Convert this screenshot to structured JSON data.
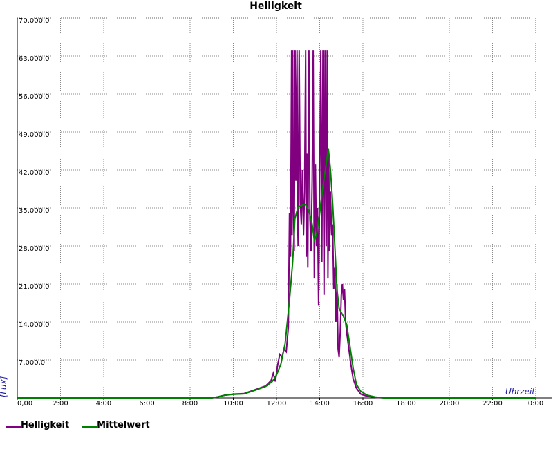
{
  "chart_data": {
    "type": "line",
    "title": "Helligkeit",
    "xlabel": "Uhrzeit",
    "ylabel": "[Lux]",
    "x_ticks": [
      "0,00",
      "2:00",
      "4:00",
      "6:00",
      "8:00",
      "10:00",
      "12:00",
      "14:00",
      "16:00",
      "18:00",
      "20:00",
      "22:00",
      "0:00"
    ],
    "y_ticks": [
      "7.000,0",
      "14.000,0",
      "21.000,0",
      "28.000,0",
      "35.000,0",
      "42.000,0",
      "49.000,0",
      "56.000,0",
      "63.000,0",
      "70.000,0"
    ],
    "xlim": [
      0,
      24
    ],
    "ylim": [
      0,
      70000
    ],
    "grid": true,
    "legend_position": "bottom-left",
    "series": [
      {
        "name": "Helligkeit",
        "color": "#800080",
        "points": [
          [
            0,
            0
          ],
          [
            9.0,
            0
          ],
          [
            9.3,
            200
          ],
          [
            9.6,
            500
          ],
          [
            10.0,
            700
          ],
          [
            10.5,
            800
          ],
          [
            11.0,
            1500
          ],
          [
            11.5,
            2200
          ],
          [
            11.75,
            3200
          ],
          [
            11.85,
            4500
          ],
          [
            11.95,
            3000
          ],
          [
            12.05,
            6000
          ],
          [
            12.15,
            8000
          ],
          [
            12.25,
            7500
          ],
          [
            12.35,
            9000
          ],
          [
            12.45,
            8500
          ],
          [
            12.55,
            13000
          ],
          [
            12.6,
            34000
          ],
          [
            12.65,
            26000
          ],
          [
            12.7,
            64000
          ],
          [
            12.72,
            30000
          ],
          [
            12.75,
            64000
          ],
          [
            12.78,
            36000
          ],
          [
            12.82,
            27000
          ],
          [
            12.86,
            64000
          ],
          [
            12.9,
            40000
          ],
          [
            12.95,
            64000
          ],
          [
            12.98,
            33000
          ],
          [
            13.0,
            28000
          ],
          [
            13.05,
            64000
          ],
          [
            13.1,
            36000
          ],
          [
            13.15,
            32000
          ],
          [
            13.2,
            42000
          ],
          [
            13.25,
            30000
          ],
          [
            13.3,
            38000
          ],
          [
            13.35,
            64000
          ],
          [
            13.38,
            26000
          ],
          [
            13.42,
            45000
          ],
          [
            13.45,
            24000
          ],
          [
            13.5,
            64000
          ],
          [
            13.55,
            33000
          ],
          [
            13.6,
            27000
          ],
          [
            13.65,
            40000
          ],
          [
            13.7,
            64000
          ],
          [
            13.75,
            22000
          ],
          [
            13.8,
            43000
          ],
          [
            13.85,
            28000
          ],
          [
            13.9,
            35000
          ],
          [
            13.95,
            17000
          ],
          [
            14.0,
            40000
          ],
          [
            14.05,
            64000
          ],
          [
            14.1,
            25000
          ],
          [
            14.15,
            64000
          ],
          [
            14.2,
            19000
          ],
          [
            14.25,
            64000
          ],
          [
            14.3,
            28000
          ],
          [
            14.35,
            64000
          ],
          [
            14.38,
            22000
          ],
          [
            14.42,
            45000
          ],
          [
            14.45,
            27000
          ],
          [
            14.5,
            38000
          ],
          [
            14.55,
            30000
          ],
          [
            14.6,
            32000
          ],
          [
            14.65,
            20000
          ],
          [
            14.7,
            24000
          ],
          [
            14.75,
            14000
          ],
          [
            14.8,
            21000
          ],
          [
            14.85,
            9000
          ],
          [
            14.9,
            7500
          ],
          [
            14.95,
            12000
          ],
          [
            15.0,
            19000
          ],
          [
            15.05,
            21000
          ],
          [
            15.1,
            18000
          ],
          [
            15.15,
            20000
          ],
          [
            15.2,
            14000
          ],
          [
            15.25,
            12000
          ],
          [
            15.35,
            9000
          ],
          [
            15.45,
            6000
          ],
          [
            15.55,
            3500
          ],
          [
            15.7,
            1800
          ],
          [
            15.9,
            700
          ],
          [
            16.2,
            300
          ],
          [
            16.6,
            100
          ],
          [
            17.0,
            0
          ],
          [
            24,
            0
          ]
        ]
      },
      {
        "name": "Mittelwert",
        "color": "#008000",
        "points": [
          [
            0,
            0
          ],
          [
            9.0,
            0
          ],
          [
            9.3,
            200
          ],
          [
            9.6,
            500
          ],
          [
            10.0,
            650
          ],
          [
            10.5,
            750
          ],
          [
            11.0,
            1400
          ],
          [
            11.5,
            2100
          ],
          [
            11.8,
            3000
          ],
          [
            12.0,
            4200
          ],
          [
            12.2,
            6200
          ],
          [
            12.4,
            10000
          ],
          [
            12.6,
            18000
          ],
          [
            12.75,
            25000
          ],
          [
            12.85,
            33000
          ],
          [
            13.0,
            35200
          ],
          [
            13.2,
            35500
          ],
          [
            13.35,
            35600
          ],
          [
            13.5,
            34500
          ],
          [
            13.65,
            32000
          ],
          [
            13.75,
            29000
          ],
          [
            13.85,
            30000
          ],
          [
            14.0,
            34000
          ],
          [
            14.15,
            39000
          ],
          [
            14.3,
            43000
          ],
          [
            14.4,
            46000
          ],
          [
            14.5,
            42000
          ],
          [
            14.6,
            36000
          ],
          [
            14.7,
            28000
          ],
          [
            14.8,
            20000
          ],
          [
            14.9,
            16500
          ],
          [
            15.1,
            15000
          ],
          [
            15.25,
            13500
          ],
          [
            15.4,
            9500
          ],
          [
            15.55,
            5500
          ],
          [
            15.7,
            2500
          ],
          [
            15.9,
            1200
          ],
          [
            16.2,
            500
          ],
          [
            16.6,
            150
          ],
          [
            17.0,
            0
          ],
          [
            24,
            0
          ]
        ]
      }
    ]
  }
}
